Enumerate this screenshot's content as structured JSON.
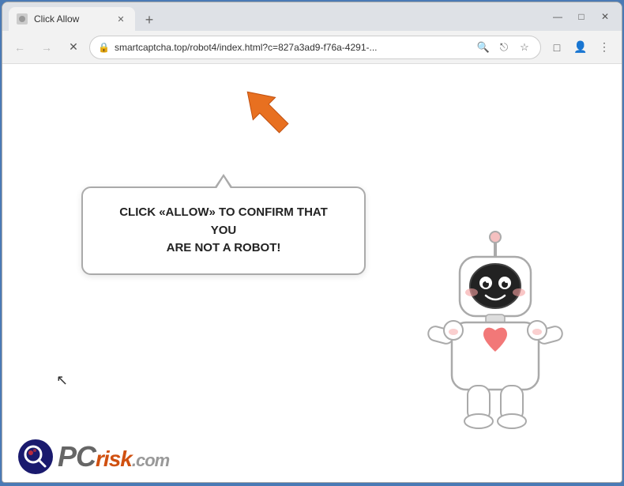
{
  "browser": {
    "tab": {
      "title": "Click Allow",
      "favicon": "🔒"
    },
    "new_tab_label": "+",
    "window_controls": {
      "minimize": "—",
      "maximize": "□",
      "close": "✕"
    },
    "nav": {
      "back": "←",
      "forward": "→",
      "reload": "✕"
    },
    "address": {
      "lock": "🔒",
      "url": "smartcaptcha.top/robot4/index.html?c=827a3ad9-f76a-4291-...",
      "search_icon": "🔍",
      "share_icon": "⎋",
      "star_icon": "☆",
      "extensions_icon": "□",
      "profile_icon": "👤",
      "menu_icon": "⋮"
    }
  },
  "page": {
    "bubble_text_line1": "CLICK «ALLOW» TO CONFIRM THAT YOU",
    "bubble_text_line2": "ARE NOT A ROBOT!",
    "arrow_direction": "up-right",
    "robot_present": true
  },
  "pcrisk": {
    "text": "PC",
    "risk": "risk",
    "com": ".com"
  }
}
